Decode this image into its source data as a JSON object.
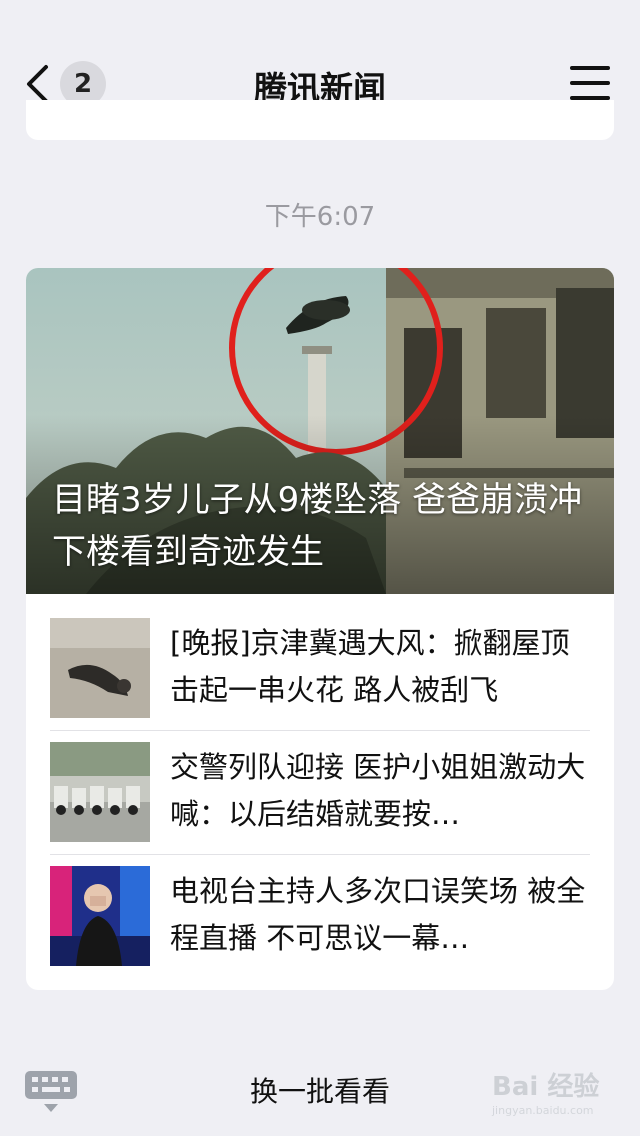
{
  "nav": {
    "title": "腾讯新闻",
    "back_badge": "2"
  },
  "timestamp": "下午6:07",
  "hero": {
    "title": "目睹3岁儿子从9楼坠落 爸爸崩溃冲下楼看到奇迹发生"
  },
  "items": [
    {
      "title": "[晚报]京津冀遇大风：掀翻屋顶击起一串火花 路人被刮飞"
    },
    {
      "title": "交警列队迎接 医护小姐姐激动大喊：以后结婚就要按…"
    },
    {
      "title": "电视台主持人多次口误笑场 被全程直播 不可思议一幕…"
    }
  ],
  "footer": {
    "more_label": "换一批看看"
  },
  "watermark": {
    "text": "Bai 经验",
    "sub": "jingyan.baidu.com"
  },
  "icons": {
    "back": "chevron-left-icon",
    "menu": "hamburger-icon",
    "keyboard": "keyboard-icon"
  }
}
